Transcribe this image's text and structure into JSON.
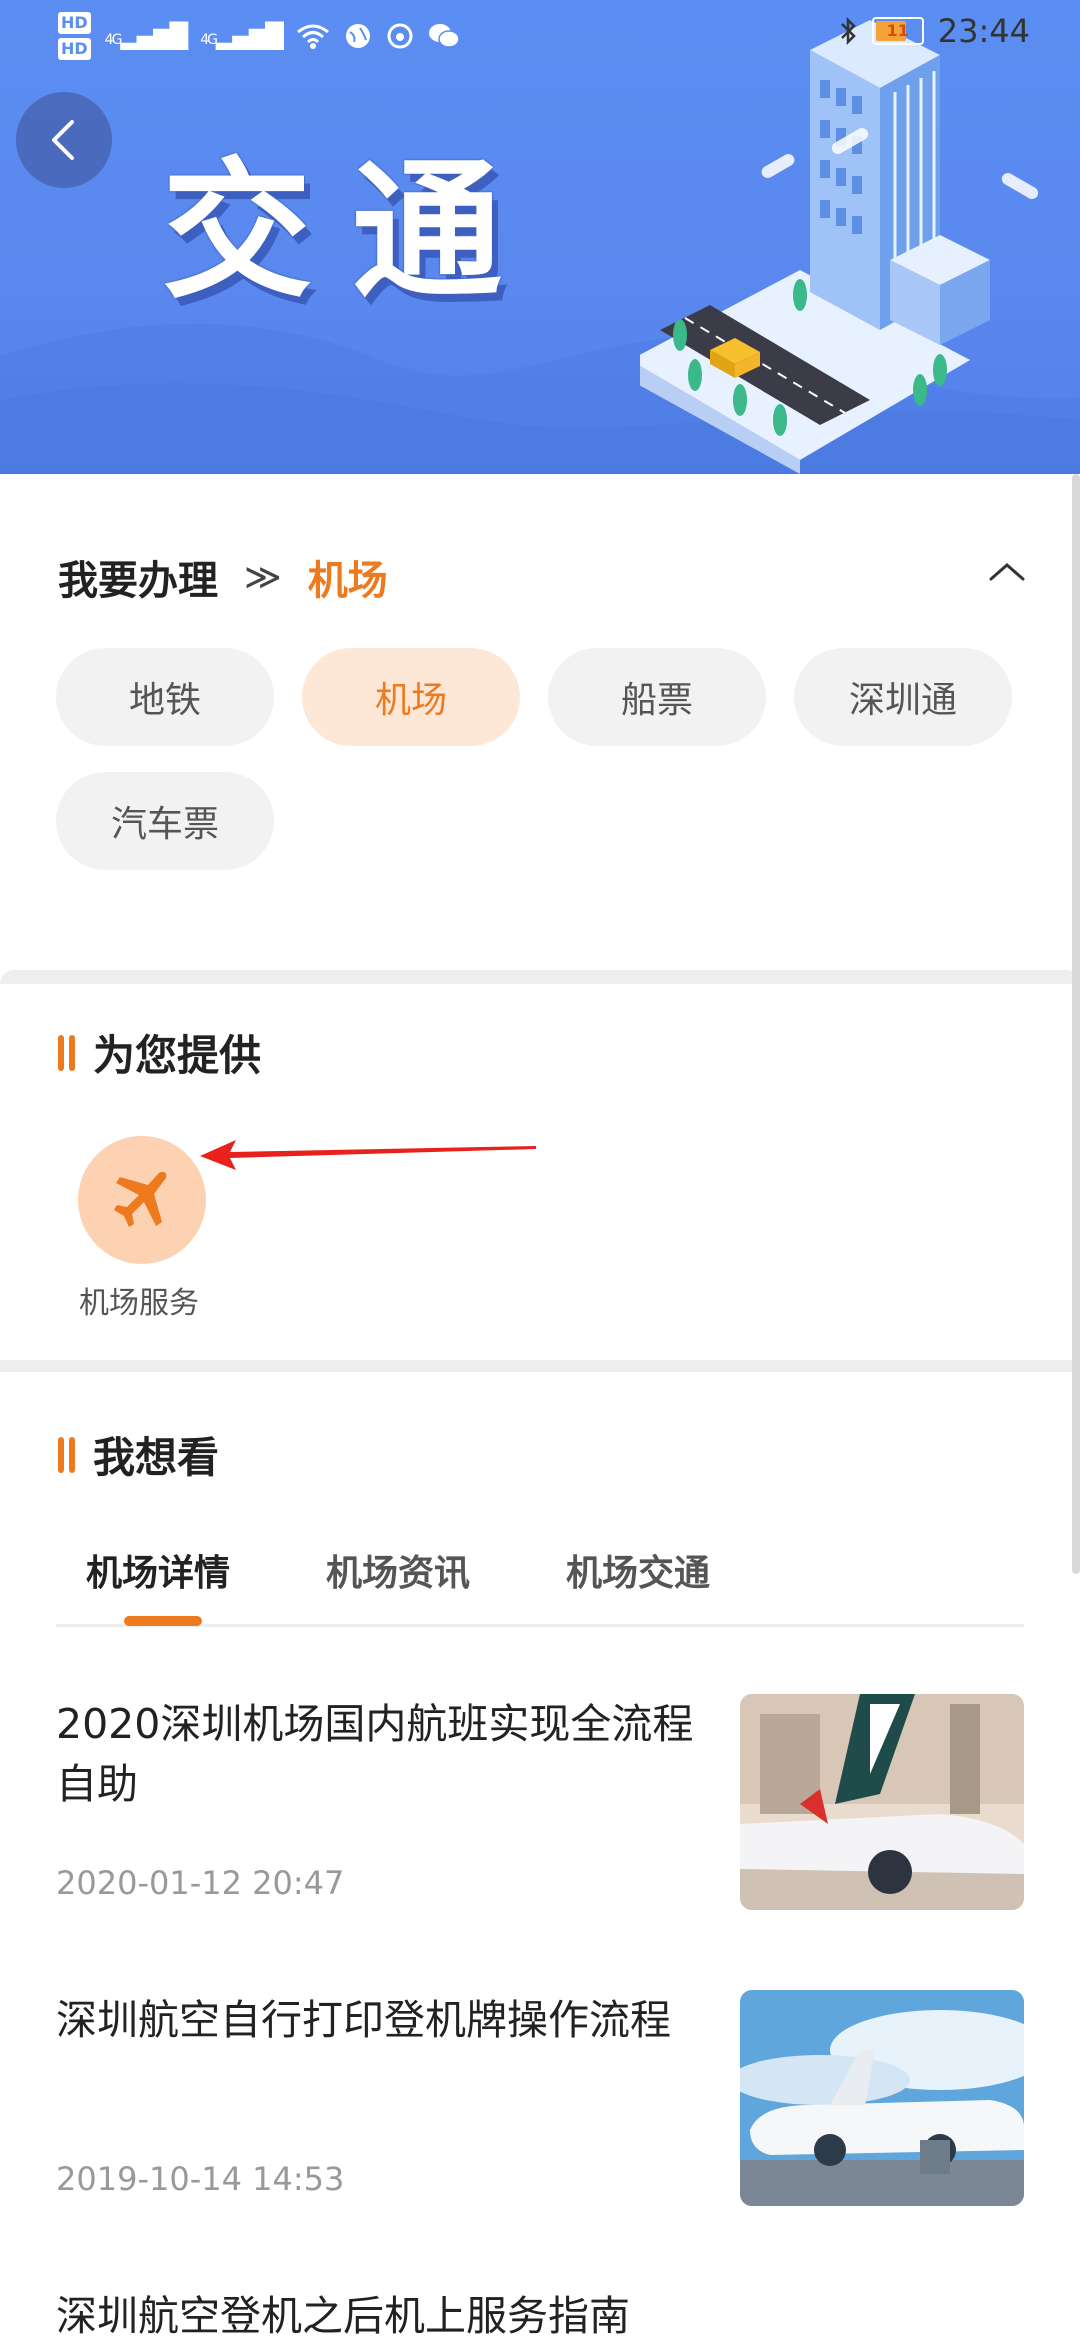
{
  "status_bar": {
    "hd1": "HD",
    "hd2": "HD",
    "signal1": "4G",
    "signal2": "4G",
    "battery_level": "11",
    "time": "23:44"
  },
  "banner": {
    "title": "交通"
  },
  "handle": {
    "prefix": "我要办理",
    "separator": "≫",
    "current": "机场",
    "chips": [
      "地铁",
      "机场",
      "船票",
      "深圳通",
      "汽车票"
    ],
    "active_chip": "机场"
  },
  "provide": {
    "heading": "为您提供",
    "services": [
      {
        "label": "机场服务",
        "icon": "airplane-icon"
      }
    ]
  },
  "want_see": {
    "heading": "我想看",
    "tabs": [
      "机场详情",
      "机场资讯",
      "机场交通"
    ],
    "active_tab": "机场详情",
    "articles": [
      {
        "title": "2020深圳机场国内航班实现全流程自助",
        "date": "2020-01-12 20:47"
      },
      {
        "title": "深圳航空自行打印登机牌操作流程",
        "date": "2019-10-14 14:53"
      },
      {
        "title": "深圳航空登机之后机上服务指南",
        "date": ""
      }
    ]
  },
  "colors": {
    "accent": "#ee7a1f",
    "banner": "#5b8ef2",
    "chip_bg": "#f2f2f2",
    "chip_active_bg": "#fde8d8"
  }
}
